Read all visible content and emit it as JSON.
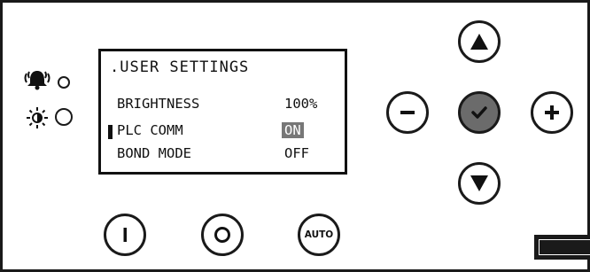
{
  "screen": {
    "title": ".USER SETTINGS",
    "rows": [
      {
        "label": "BRIGHTNESS",
        "value": "100%"
      },
      {
        "label": "PLC COMM",
        "value": "ON",
        "selected": true
      },
      {
        "label": "BOND MODE",
        "value": "OFF"
      }
    ]
  },
  "buttons": {
    "auto_label": "AUTO"
  },
  "icons": {
    "alarm": "alarm-bell-icon",
    "brightness": "sun-icon",
    "up": "arrow-up-icon",
    "down": "arrow-down-icon",
    "minus": "minus-icon",
    "plus": "plus-icon",
    "confirm": "check-icon",
    "power_on": "power-on-icon",
    "power_off": "power-off-icon"
  },
  "colors": {
    "outline": "#1a1a1a",
    "confirm_fill": "#6b6b6b",
    "highlight_fill": "#777777"
  }
}
